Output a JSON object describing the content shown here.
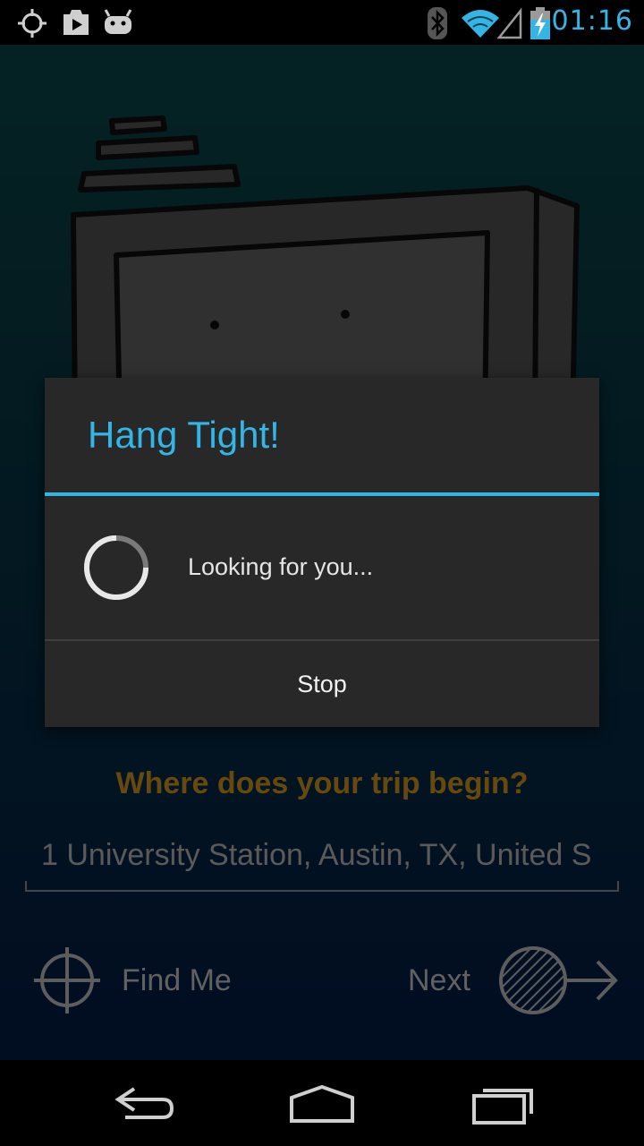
{
  "status_bar": {
    "time": "01:16",
    "icons": [
      "gps-icon",
      "play-store-icon",
      "android-icon",
      "bluetooth-icon",
      "wifi-icon",
      "signal-icon",
      "battery-charging-icon"
    ]
  },
  "colors": {
    "accent": "#33b5e5",
    "question": "#e2a21f",
    "dialog_bg": "#282828"
  },
  "main": {
    "question": "Where does your trip begin?",
    "address_value": "1 University Station, Austin, TX, United S",
    "find_me_label": "Find Me",
    "next_label": "Next"
  },
  "dialog": {
    "title": "Hang Tight!",
    "message": "Looking for you...",
    "stop_label": "Stop"
  },
  "nav_bar": {
    "icons": [
      "back-icon",
      "home-icon",
      "recent-apps-icon"
    ]
  }
}
